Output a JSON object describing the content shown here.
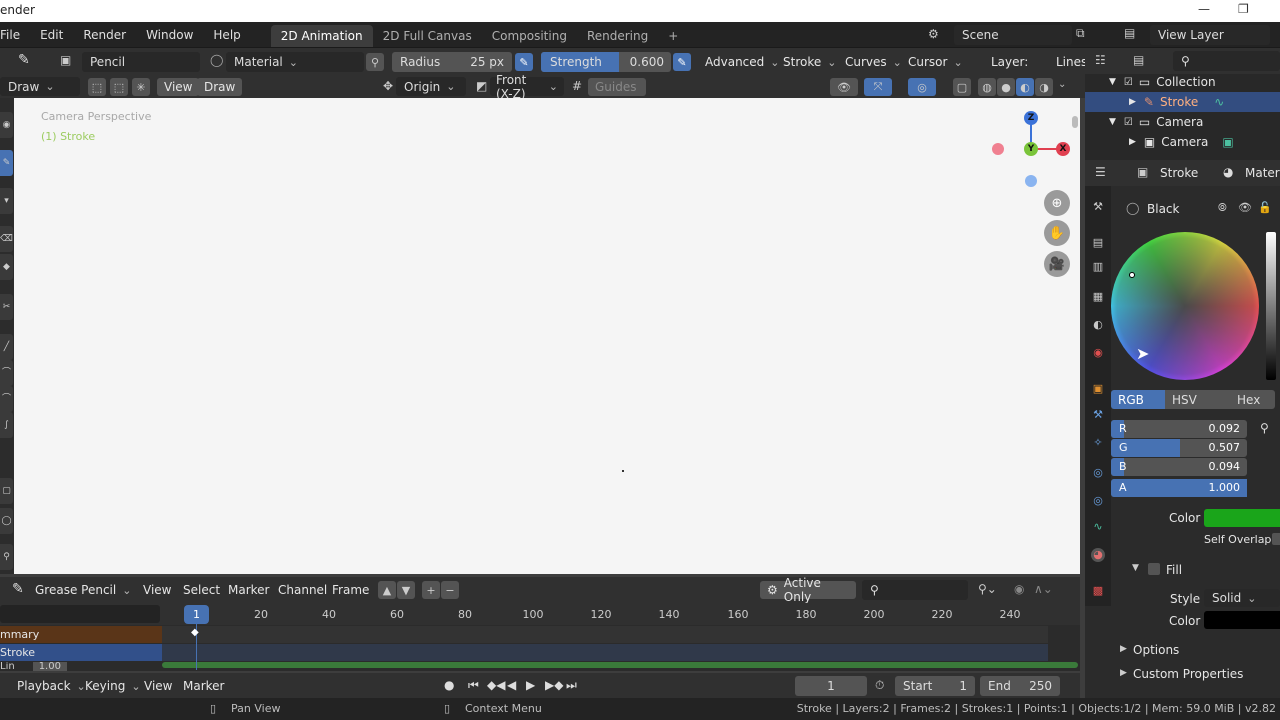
{
  "titlebar": {
    "title": "ender",
    "ctl_min": "—",
    "ctl_max": "❐"
  },
  "menu": {
    "file": "File",
    "edit": "Edit",
    "render": "Render",
    "window": "Window",
    "help": "Help"
  },
  "workspaces": [
    "2D Animation",
    "2D Full Canvas",
    "Compositing",
    "Rendering",
    "+"
  ],
  "scene": {
    "label": "Scene",
    "view_layer": "View Layer"
  },
  "tool_header": {
    "brush": "Pencil",
    "material": "Material",
    "radius_label": "Radius",
    "radius_value": "25 px",
    "strength_label": "Strength",
    "strength_value": "0.600",
    "strength_fraction": 0.6,
    "advanced": "Advanced",
    "stroke": "Stroke",
    "curves": "Curves",
    "cursor": "Cursor",
    "layer_label": "Layer:",
    "layer_value": "Lines"
  },
  "viewport_header": {
    "mode": "Draw",
    "view": "View",
    "draw": "Draw",
    "origin": "Origin",
    "projection": "Front (X-Z)",
    "guides": "Guides"
  },
  "viewport": {
    "info_line1": "Camera Perspective",
    "info_line2": "(1) Stroke",
    "axis_z": "Z",
    "axis_y": "Y",
    "axis_x": "X"
  },
  "outliner": {
    "items": [
      "Collection",
      "Stroke",
      "Camera",
      "Camera"
    ]
  },
  "properties": {
    "tab_stroke": "Stroke",
    "tab_material": "Materia",
    "material_name": "Black",
    "color_tabs": [
      "RGB",
      "HSV",
      "Hex"
    ],
    "channels": [
      {
        "label": "R",
        "value": "0.092",
        "fill": 0.092
      },
      {
        "label": "G",
        "value": "0.507",
        "fill": 0.507
      },
      {
        "label": "B",
        "value": "0.094",
        "fill": 0.094
      },
      {
        "label": "A",
        "value": "1.000",
        "fill": 1.0
      }
    ],
    "color_label": "Color",
    "color_swatch": "#1aa51a",
    "self_overlap": "Self Overlap",
    "fill_label": "Fill",
    "style_label": "Style",
    "style_value": "Solid",
    "fill_color_label": "Color",
    "fill_color_swatch": "#000000",
    "options": "Options",
    "custom_props": "Custom Properties"
  },
  "dopesheet": {
    "editor": "Grease Pencil",
    "view": "View",
    "select": "Select",
    "marker": "Marker",
    "channel": "Channel",
    "frame": "Frame",
    "active_only": "Active Only",
    "current_frame": "1",
    "ticks": [
      "20",
      "40",
      "60",
      "80",
      "100",
      "120",
      "140",
      "160",
      "180",
      "200",
      "220",
      "240"
    ],
    "summary": "mmary",
    "stroke_channel": "Stroke",
    "layer_opacity": "1.00",
    "layer_prefix": "Lin"
  },
  "playback": {
    "playback": "Playback",
    "keying": "Keying",
    "view": "View",
    "marker": "Marker",
    "frame": "1",
    "start_label": "Start",
    "start": "1",
    "end_label": "End",
    "end": "250"
  },
  "status": {
    "pan": "Pan View",
    "context": "Context Menu",
    "info": "Stroke | Layers:2 | Frames:2 | Strokes:1 | Points:1 | Objects:1/2 | Mem: 59.0 MiB | v2.82"
  },
  "colors": {
    "accent": "#4772b3",
    "selection": "#334d80",
    "stroke_green": "#9ccc60"
  }
}
